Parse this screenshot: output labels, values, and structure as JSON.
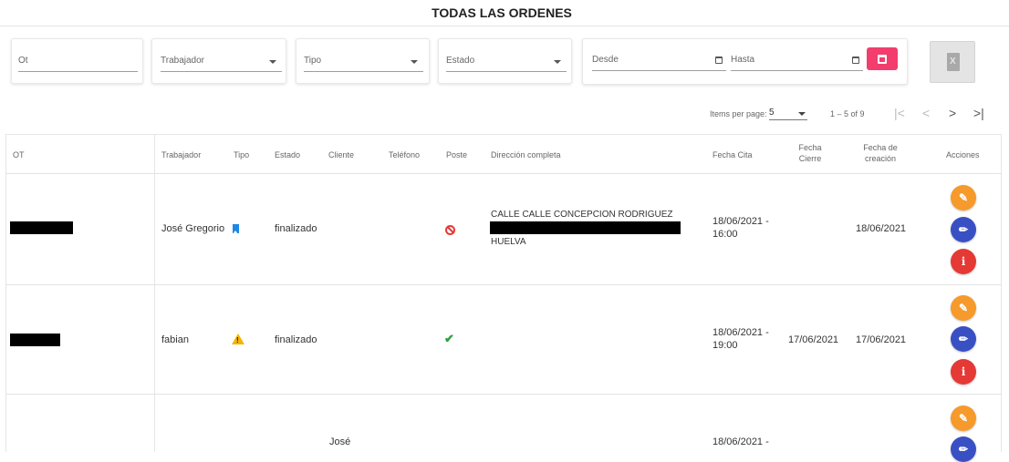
{
  "page": {
    "title": "TODAS LAS ORDENES"
  },
  "filters": {
    "ot_placeholder": "Ot",
    "trabajador_placeholder": "Trabajador",
    "tipo_placeholder": "Tipo",
    "estado_placeholder": "Estado",
    "desde_placeholder": "Desde",
    "hasta_placeholder": "Hasta"
  },
  "pager": {
    "items_per_page_label": "Items per page:",
    "page_size": "5",
    "range": "1 – 5 of 9",
    "first": "|<",
    "prev": "<",
    "next": ">",
    "last": ">|"
  },
  "table": {
    "headers": {
      "ot": "OT",
      "trabajador": "Trabajador",
      "tipo": "Tipo",
      "estado": "Estado",
      "cliente": "Cliente",
      "telefono": "Teléfono",
      "poste": "Poste",
      "direccion": "Dirección completa",
      "fecha_cita": "Fecha Cita",
      "fecha_cierre_1": "Fecha",
      "fecha_cierre_2": "Cierre",
      "fecha_creacion_1": "Fecha de",
      "fecha_creacion_2": "creación",
      "acciones": "Acciones"
    },
    "rows": [
      {
        "trabajador": "José Gregorio",
        "tipo_icon": "bookmark-icon",
        "estado": "finalizado",
        "poste_icon": "block-icon",
        "direccion_line1": "CALLE CALLE CONCEPCION RODRIGUEZ",
        "direccion_line3": "HUELVA",
        "fecha_cita_1": "18/06/2021 -",
        "fecha_cita_2": "16:00",
        "fecha_cierre": "",
        "fecha_creacion": "18/06/2021"
      },
      {
        "trabajador": "fabian",
        "tipo_icon": "warning-icon",
        "estado": "finalizado",
        "poste_icon": "check-icon",
        "fecha_cita_1": "18/06/2021 -",
        "fecha_cita_2": "19:00",
        "fecha_cierre": "17/06/2021",
        "fecha_creacion": "17/06/2021"
      },
      {
        "cliente": "José",
        "fecha_cita_1": "18/06/2021 -"
      }
    ],
    "actions": {
      "info_glyph": "i"
    }
  },
  "colors": {
    "reset_button": "#f23d6d",
    "edit_doc_button": "#f59a2b",
    "edit_button": "#3950c4",
    "info_button": "#e53935"
  }
}
